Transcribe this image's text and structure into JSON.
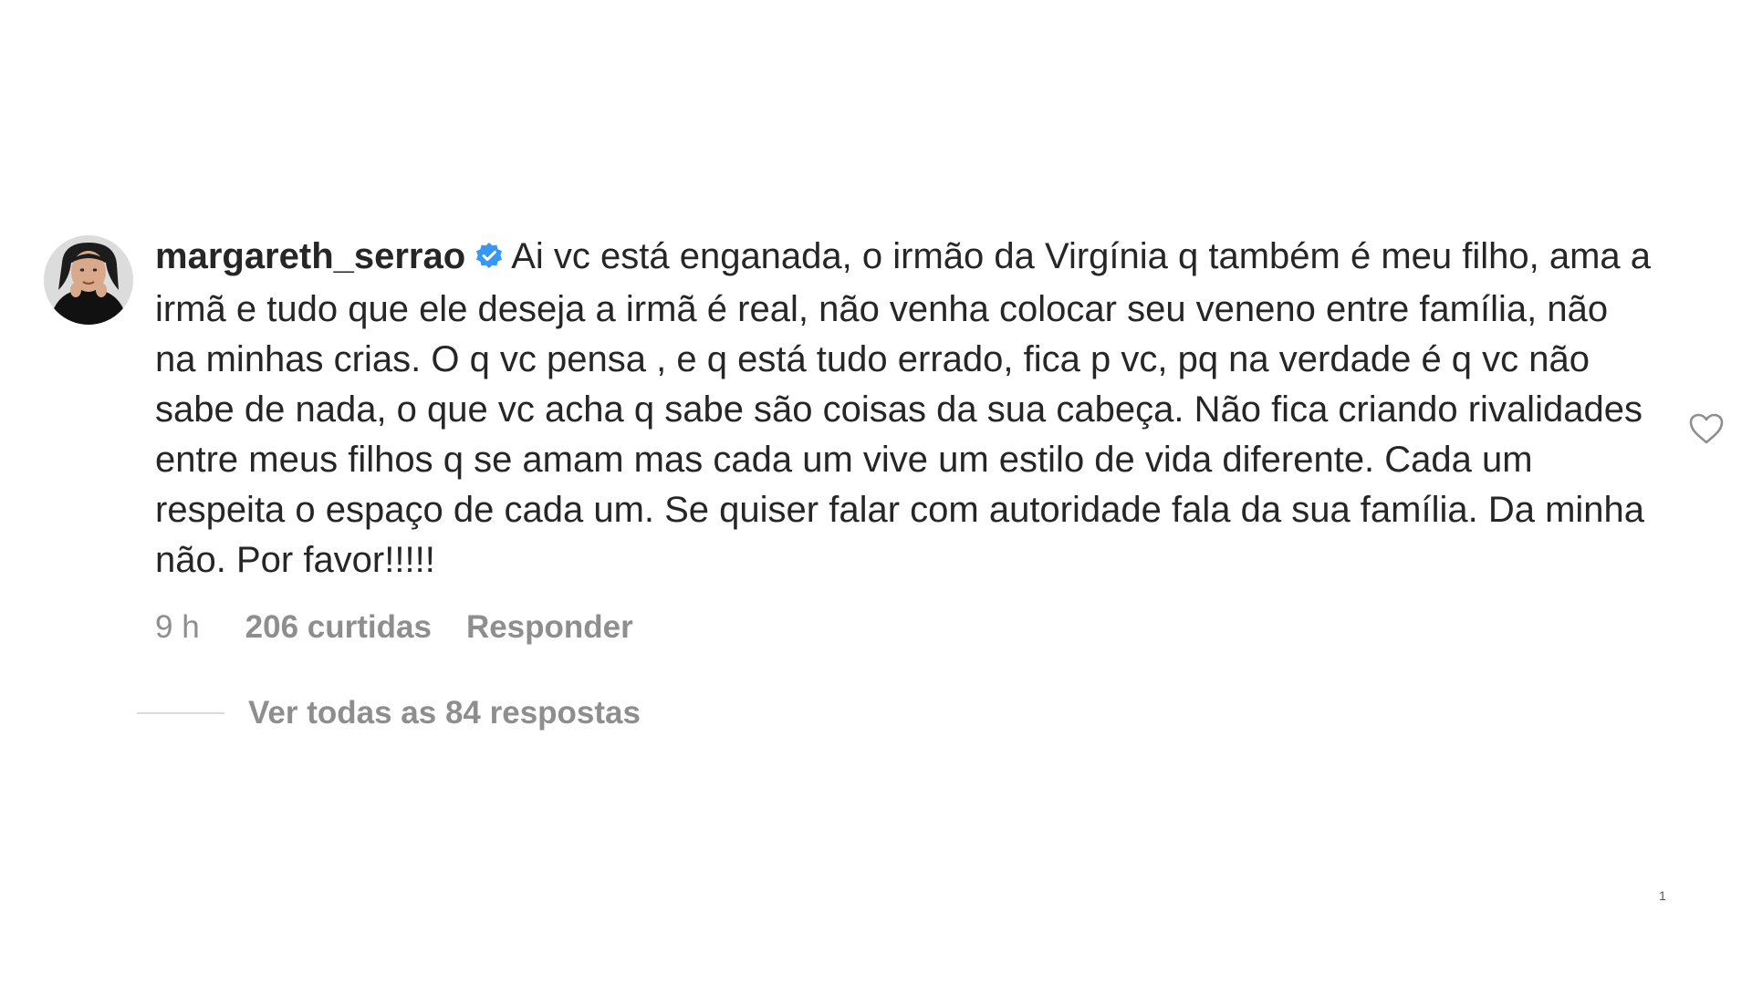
{
  "comment": {
    "username": "margareth_serrao",
    "verified_icon": "verified-badge-icon",
    "text": "Ai vc está enganada, o irmão da Virgínia q também é meu filho, ama a irmã e tudo que ele deseja a irmã é real, não venha colocar seu veneno entre família, não na minhas crias. O q vc pensa , e q está tudo errado, fica p vc, pq na verdade é q vc não sabe de nada, o que vc acha q sabe são coisas da sua cabeça. Não fica criando rivalidades entre meus filhos q se amam mas cada um vive um estilo de vida diferente. Cada um respeita o espaço de cada um. Se quiser falar com autoridade fala da sua família. Da minha não. Por favor!!!!!",
    "time": "9 h",
    "likes": "206 curtidas",
    "reply_label": "Responder",
    "like_icon": "heart-outline-icon"
  },
  "replies": {
    "label": "Ver todas as 84 respostas"
  },
  "page_number": "1",
  "colors": {
    "text": "#262626",
    "secondary": "#8e8e8e",
    "verified": "#3897f0",
    "divider": "#dbdbdb",
    "background": "#ffffff"
  }
}
